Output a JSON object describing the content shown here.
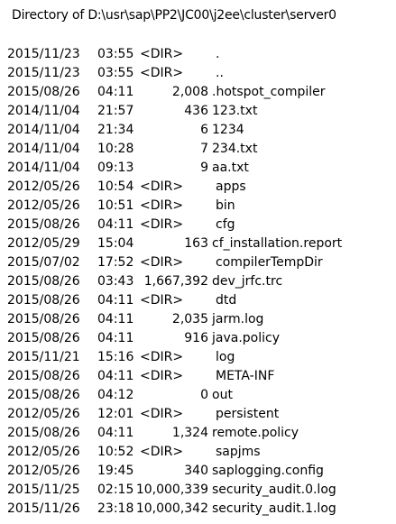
{
  "header": "Directory of D:\\usr\\sap\\PP2\\JC00\\j2ee\\cluster\\server0",
  "entries": [
    {
      "date": "2015/11/23",
      "time": "03:55",
      "type": "<DIR>",
      "size": "",
      "name": "."
    },
    {
      "date": "2015/11/23",
      "time": "03:55",
      "type": "<DIR>",
      "size": "",
      "name": ".."
    },
    {
      "date": "2015/08/26",
      "time": "04:11",
      "type": "",
      "size": "2,008",
      "name": ".hotspot_compiler"
    },
    {
      "date": "2014/11/04",
      "time": "21:57",
      "type": "",
      "size": "436",
      "name": "123.txt"
    },
    {
      "date": "2014/11/04",
      "time": "21:34",
      "type": "",
      "size": "6",
      "name": "1234"
    },
    {
      "date": "2014/11/04",
      "time": "10:28",
      "type": "",
      "size": "7",
      "name": "234.txt"
    },
    {
      "date": "2014/11/04",
      "time": "09:13",
      "type": "",
      "size": "9",
      "name": "aa.txt"
    },
    {
      "date": "2012/05/26",
      "time": "10:54",
      "type": "<DIR>",
      "size": "",
      "name": "apps"
    },
    {
      "date": "2012/05/26",
      "time": "10:51",
      "type": "<DIR>",
      "size": "",
      "name": "bin"
    },
    {
      "date": "2015/08/26",
      "time": "04:11",
      "type": "<DIR>",
      "size": "",
      "name": "cfg"
    },
    {
      "date": "2012/05/29",
      "time": "15:04",
      "type": "",
      "size": "163",
      "name": "cf_installation.report"
    },
    {
      "date": "2015/07/02",
      "time": "17:52",
      "type": "<DIR>",
      "size": "",
      "name": "compilerTempDir"
    },
    {
      "date": "2015/08/26",
      "time": "03:43",
      "type": "",
      "size": "1,667,392",
      "name": "dev_jrfc.trc"
    },
    {
      "date": "2015/08/26",
      "time": "04:11",
      "type": "<DIR>",
      "size": "",
      "name": "dtd"
    },
    {
      "date": "2015/08/26",
      "time": "04:11",
      "type": "",
      "size": "2,035",
      "name": "jarm.log"
    },
    {
      "date": "2015/08/26",
      "time": "04:11",
      "type": "",
      "size": "916",
      "name": "java.policy"
    },
    {
      "date": "2015/11/21",
      "time": "15:16",
      "type": "<DIR>",
      "size": "",
      "name": "log"
    },
    {
      "date": "2015/08/26",
      "time": "04:11",
      "type": "<DIR>",
      "size": "",
      "name": "META-INF"
    },
    {
      "date": "2015/08/26",
      "time": "04:12",
      "type": "",
      "size": "0",
      "name": "out"
    },
    {
      "date": "2012/05/26",
      "time": "12:01",
      "type": "<DIR>",
      "size": "",
      "name": "persistent"
    },
    {
      "date": "2015/08/26",
      "time": "04:11",
      "type": "",
      "size": "1,324",
      "name": "remote.policy"
    },
    {
      "date": "2012/05/26",
      "time": "10:52",
      "type": "<DIR>",
      "size": "",
      "name": "sapjms"
    },
    {
      "date": "2012/05/26",
      "time": "19:45",
      "type": "",
      "size": "340",
      "name": "saplogging.config"
    },
    {
      "date": "2015/11/25",
      "time": "02:15",
      "type": "",
      "size": "10,000,339",
      "name": "security_audit.0.log"
    },
    {
      "date": "2015/11/26",
      "time": "23:18",
      "type": "",
      "size": "10,000,342",
      "name": "security_audit.1.log"
    }
  ]
}
